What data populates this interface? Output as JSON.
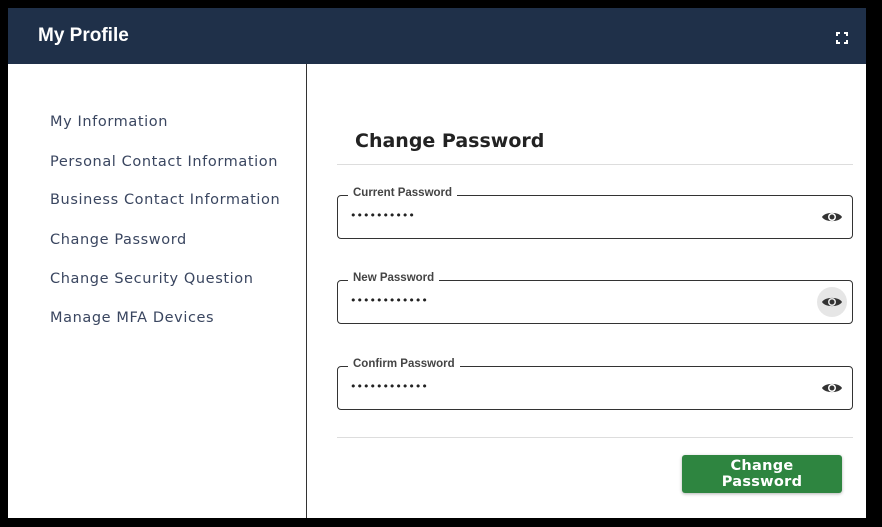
{
  "header": {
    "title": "My Profile"
  },
  "sidebar": {
    "items": [
      {
        "label": "My Information"
      },
      {
        "label": "Personal Contact Information"
      },
      {
        "label": "Business Contact Information"
      },
      {
        "label": "Change Password"
      },
      {
        "label": "Change Security Question"
      },
      {
        "label": "Manage MFA Devices"
      }
    ]
  },
  "main": {
    "title": "Change Password",
    "fields": [
      {
        "label": "Current Password",
        "value": "••••••••••"
      },
      {
        "label": "New Password",
        "value": "••••••••••••"
      },
      {
        "label": "Confirm Password",
        "value": "••••••••••••"
      }
    ],
    "submit_label": "Change Password"
  },
  "colors": {
    "header_bg": "#1f3049",
    "button_bg": "#2e8540",
    "sidebar_text": "#3a4660"
  },
  "icons": {
    "header": "expand-icon",
    "field_toggle": "eye-icon"
  }
}
